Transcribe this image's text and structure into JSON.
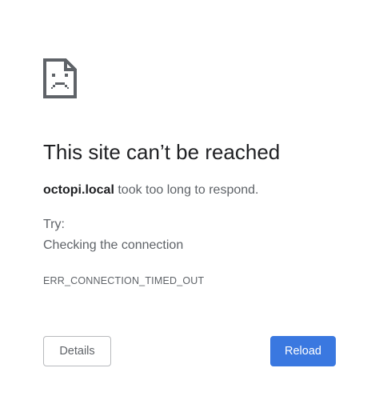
{
  "error": {
    "icon": "sad-page-icon",
    "title": "This site can’t be reached",
    "host": "octopi.local",
    "summary_suffix": " took too long to respond.",
    "try_label": "Try:",
    "suggestions": [
      "Checking the connection"
    ],
    "code": "ERR_CONNECTION_TIMED_OUT"
  },
  "buttons": {
    "details_label": "Details",
    "reload_label": "Reload"
  },
  "colors": {
    "accent": "#3a78e0",
    "text_primary": "#202124",
    "text_secondary": "#5f6368",
    "icon": "#5f6368"
  }
}
